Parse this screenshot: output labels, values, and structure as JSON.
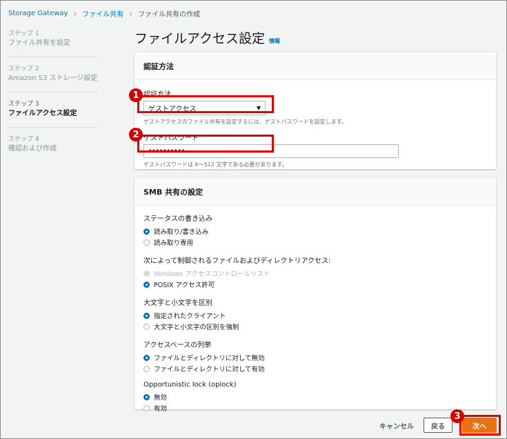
{
  "breadcrumb": {
    "items": [
      "Storage Gateway",
      "ファイル共有"
    ],
    "current": "ファイル共有の作成"
  },
  "steps": [
    {
      "num": "ステップ 1",
      "name": "ファイル共有を設定"
    },
    {
      "num": "ステップ 2",
      "name": "Amazon S3 ストレージ設定"
    },
    {
      "num": "ステップ 3",
      "name": "ファイルアクセス設定",
      "active": true
    },
    {
      "num": "ステップ 4",
      "name": "確認および作成"
    }
  ],
  "page": {
    "title": "ファイルアクセス設定",
    "info": "情報"
  },
  "auth_panel": {
    "header": "認証方法",
    "method_label": "認証方法",
    "method_value": "ゲストアクセス",
    "method_hint": "ゲストアクセスのファイル共有を設定するには、ゲストパスワードを設定します。",
    "password_label": "ゲストパスワード",
    "password_value": "••••••••••",
    "password_hint": "ゲストパスワードは 6～512 文字である必要があります。"
  },
  "smb_panel": {
    "header": "SMB 共有の設定",
    "groups": [
      {
        "title": "ステータスの書き込み",
        "options": [
          {
            "label": "読み取り/書き込み",
            "checked": true
          },
          {
            "label": "読み取り専用"
          }
        ]
      },
      {
        "title": "次によって制御されるファイルおよびディレクトリアクセス:",
        "options": [
          {
            "label": "Windows アクセスコントロールリスト",
            "disabled": true
          },
          {
            "label": "POSIX アクセス許可",
            "checked": true
          }
        ]
      },
      {
        "title": "大文字と小文字を区別",
        "options": [
          {
            "label": "指定されたクライアント",
            "checked": true
          },
          {
            "label": "大文字と小文字の区別を強制"
          }
        ]
      },
      {
        "title": "アクセスベースの列挙",
        "options": [
          {
            "label": "ファイルとディレクトリに対して無効",
            "checked": true
          },
          {
            "label": "ファイルとディレクトリに対して有効"
          }
        ]
      },
      {
        "title": "Opportunistic lock (oplock)",
        "options": [
          {
            "label": "無効",
            "checked": true
          },
          {
            "label": "有効"
          }
        ]
      }
    ]
  },
  "footer": {
    "cancel": "キャンセル",
    "back": "戻る",
    "next": "次へ"
  },
  "callouts": [
    "1",
    "2",
    "3"
  ],
  "colors": {
    "accent": "#0073bb",
    "primary": "#ec7211",
    "callout": "#e00000"
  }
}
